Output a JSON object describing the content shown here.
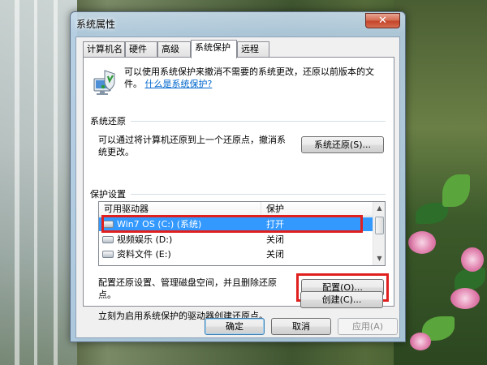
{
  "window": {
    "title": "系统属性",
    "close_glyph": "✕"
  },
  "tabs": [
    {
      "label": "计算机名"
    },
    {
      "label": "硬件"
    },
    {
      "label": "高级"
    },
    {
      "label": "系统保护",
      "active": true
    },
    {
      "label": "远程"
    }
  ],
  "intro": {
    "text": "可以使用系统保护来撤消不需要的系统更改，还原以前版本的文件。",
    "link": "什么是系统保护?"
  },
  "restore": {
    "group_title": "系统还原",
    "text": "可以通过将计算机还原到上一个还原点，撤消系统更改。",
    "button": "系统还原(S)..."
  },
  "protection": {
    "group_title": "保护设置",
    "columns": [
      "可用驱动器",
      "保护"
    ],
    "drives": [
      {
        "name": "Win7 OS (C:) (系统)",
        "status": "打开",
        "selected": true
      },
      {
        "name": "视频娱乐 (D:)",
        "status": "关闭"
      },
      {
        "name": "资料文件 (E:)",
        "status": "关闭"
      }
    ],
    "config_text": "配置还原设置、管理磁盘空间，并且删除还原点。",
    "config_button": "配置(O)...",
    "create_text": "立刻为启用系统保护的驱动器创建还原点。",
    "create_button": "创建(C)..."
  },
  "footer": {
    "ok": "确定",
    "cancel": "取消",
    "apply": "应用(A)"
  },
  "colors": {
    "highlight_box": "#e0201f",
    "selection": "#3399ff",
    "link": "#0066cc"
  }
}
